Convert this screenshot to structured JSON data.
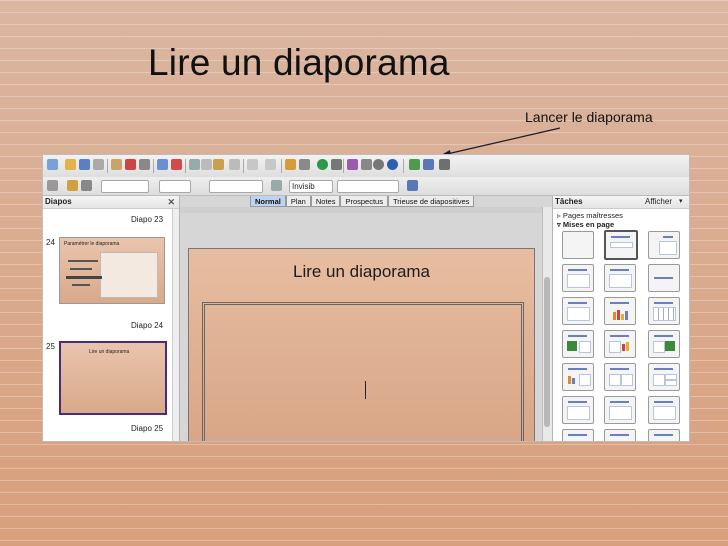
{
  "slide": {
    "title": "Lire un diaporama",
    "callout": "Lancer le diaporama"
  },
  "toolbar": {
    "view_field": "Invisib"
  },
  "slides_panel": {
    "title": "Diapos",
    "items": [
      {
        "number": "",
        "caption": "Diapo 23"
      },
      {
        "number": "24",
        "caption": "Diapo 24",
        "thumb_title": "Paramétrer le diaporama"
      },
      {
        "number": "25",
        "caption": "Diapo 25",
        "thumb_title": "Lire un diaporama"
      }
    ]
  },
  "view_tabs": [
    "Normal",
    "Plan",
    "Notes",
    "Prospectus",
    "Trieuse de diapositives"
  ],
  "editor": {
    "slide_title": "Lire un diaporama"
  },
  "tasks_panel": {
    "title": "Tâches",
    "view_menu": "Afficher",
    "sections": [
      "Pages maîtresses",
      "Mises en page"
    ]
  },
  "colors": {
    "accent": "#4a2a7a",
    "arrow": "#1b1b2a",
    "tab_active": "#bcd3f2"
  }
}
